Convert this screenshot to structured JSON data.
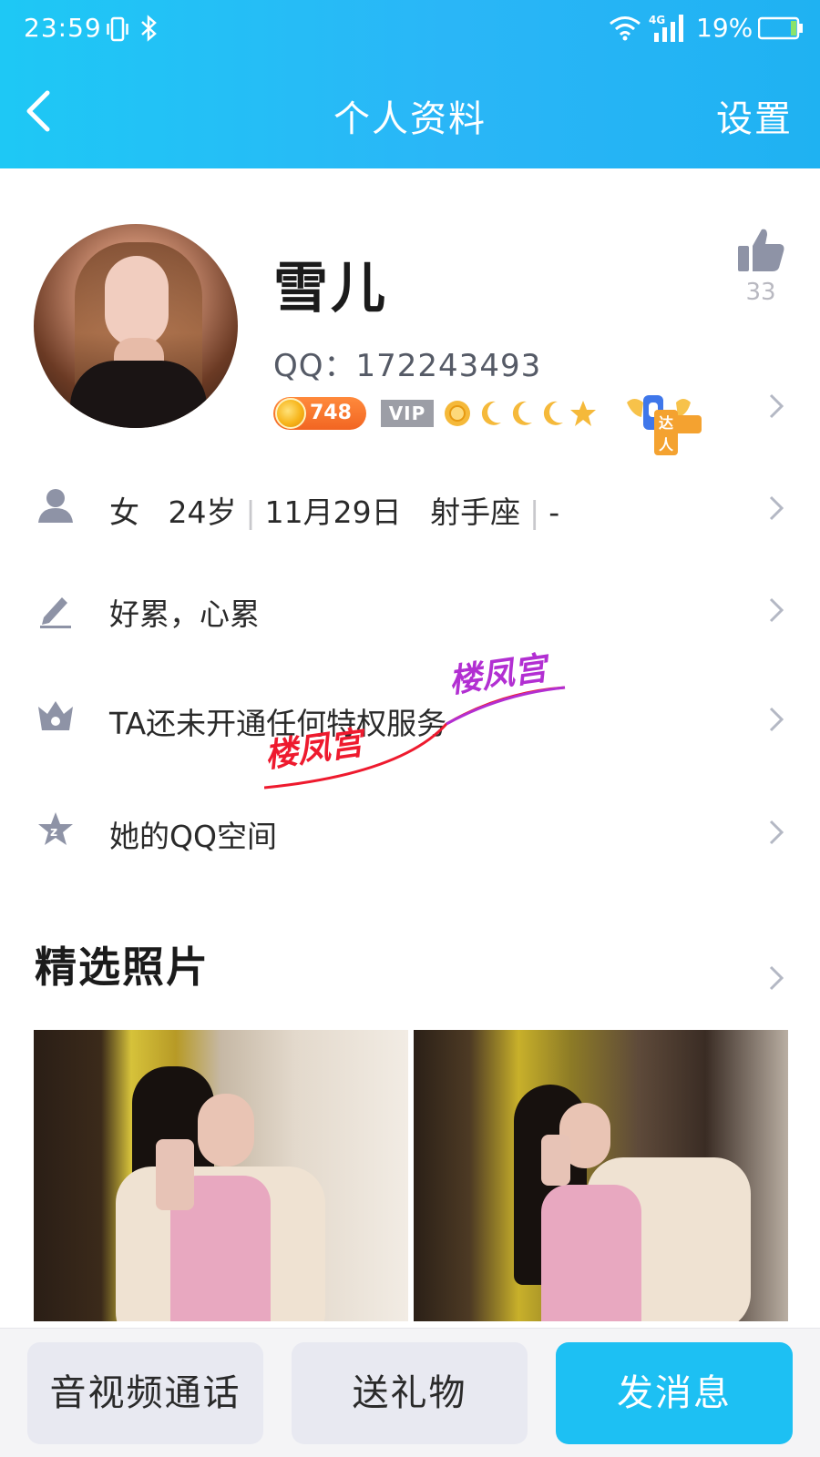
{
  "status_bar": {
    "time": "23:59",
    "battery_percent": "19%",
    "network": "4G"
  },
  "nav": {
    "title": "个人资料",
    "settings_label": "设置"
  },
  "profile": {
    "name": "雪儿",
    "qq_label": "QQ：172243493",
    "likes": "33",
    "coins": "748",
    "vip_label": "VIP",
    "daren_label": "达人"
  },
  "rows": {
    "info": {
      "gender": "女",
      "age": "24岁",
      "birthday": "11月29日",
      "zodiac": "射手座",
      "extra": "-"
    },
    "signature": "好累，心累",
    "privilege": "TA还未开通任何特权服务",
    "qzone": "她的QQ空间"
  },
  "watermark": {
    "text": "楼凤宫"
  },
  "photos": {
    "section_title": "精选照片"
  },
  "actions": {
    "call": "音视频通话",
    "gift": "送礼物",
    "message": "发消息"
  },
  "colors": {
    "header": "#1ec8f5",
    "primary_button": "#1dc0f3",
    "coin": "#f26522",
    "vip": "#9c9ea6",
    "icon_gray": "#8e93a6"
  }
}
